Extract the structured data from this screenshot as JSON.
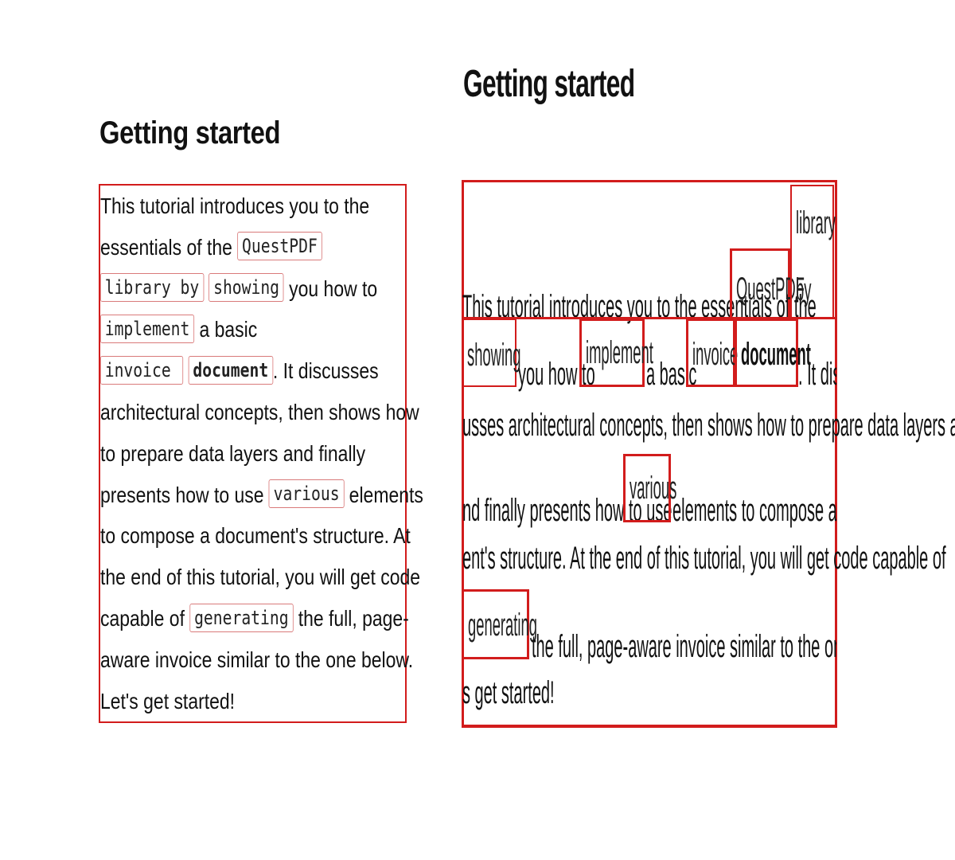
{
  "left": {
    "title": "Getting started",
    "lines": [
      "This tutorial introduces you to the",
      "essentials of the",
      "you how to",
      "a basic",
      ". It discusses",
      "architectural concepts, then shows how",
      "to prepare data layers and finally",
      "presents how to use",
      "elements",
      "to compose a document's structure. At",
      "the end of this tutorial, you will get code",
      "capable of",
      "the full, page-",
      "aware invoice similar to the one below.",
      "Let's get started!"
    ],
    "codes": {
      "questpdf": "QuestPDF",
      "library": "library by",
      "showing": "showing",
      "implement": "implement",
      "invoice": "invoice",
      "document": "document",
      "various": "various",
      "generating": "generating"
    }
  },
  "right": {
    "title": "Getting started",
    "rows": [
      "This tutorial introduces you to the essentials of the",
      "you how to",
      "a basic",
      ". It disc",
      "usses architectural concepts, then shows how to prepare data layers a",
      "nd finally presents how to use",
      "elements to compose a docum",
      "ent's structure. At the end of this tutorial, you will get code capable of",
      "the full, page-aware invoice similar to the one below. Let'",
      "s get started!"
    ],
    "boxes": {
      "questpdf": "QuestPDF",
      "library": "library",
      "by": "by",
      "showing": "showing",
      "implement": "implement",
      "invoice": "invoice",
      "document": "document",
      "various": "various",
      "generating": "generating"
    }
  }
}
